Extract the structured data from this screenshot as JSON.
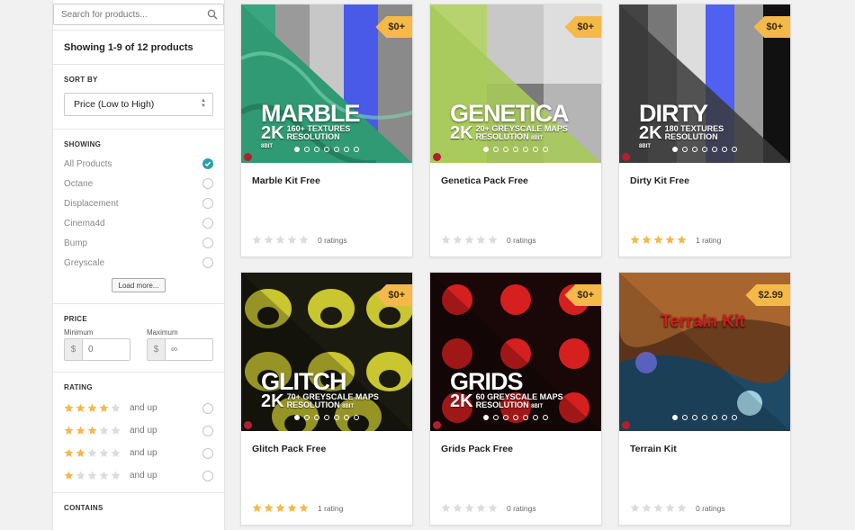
{
  "search": {
    "placeholder": "Search for products..."
  },
  "showing_count": "Showing 1-9 of 12 products",
  "sort": {
    "title": "SORT BY",
    "value": "Price (Low to High)"
  },
  "filter": {
    "title": "SHOWING",
    "options": [
      {
        "label": "All Products",
        "checked": true
      },
      {
        "label": "Octane",
        "checked": false
      },
      {
        "label": "Displacement",
        "checked": false
      },
      {
        "label": "Cinema4d",
        "checked": false
      },
      {
        "label": "Bump",
        "checked": false
      },
      {
        "label": "Greyscale",
        "checked": false
      }
    ],
    "load_more": "Load more..."
  },
  "price": {
    "title": "PRICE",
    "min_label": "Minimum",
    "max_label": "Maximum",
    "currency": "$",
    "min_placeholder": "0",
    "max_placeholder": "∞"
  },
  "rating": {
    "title": "RATING",
    "and_up": "and up",
    "levels": [
      4,
      3,
      2,
      1
    ]
  },
  "contains": {
    "title": "CONTAINS"
  },
  "colors": {
    "accent": "#2aa0a8",
    "star": "#f5b94a",
    "star_empty": "#dcdcdc",
    "tag": "#f5b94a"
  },
  "products": [
    {
      "name": "Marble Kit Free",
      "price": "$0+",
      "title": "MARBLE",
      "res": "2K",
      "line1": "160+ TEXTURES",
      "line2": "RESOLUTION",
      "line3": "8BIT",
      "rating": 0,
      "ratings_text": "0 ratings"
    },
    {
      "name": "Genetica Pack Free",
      "price": "$0+",
      "title": "GENETICA",
      "res": "2K",
      "line1": "20+ GREYSCALE MAPS",
      "line2": "RESOLUTION",
      "line3": "8BIT",
      "rating": 0,
      "ratings_text": "0 ratings"
    },
    {
      "name": "Dirty Kit Free",
      "price": "$0+",
      "title": "DIRTY",
      "res": "2K",
      "line1": "180 TEXTURES",
      "line2": "RESOLUTION",
      "line3": "8BIT",
      "rating": 5,
      "ratings_text": "1 rating"
    },
    {
      "name": "Glitch Pack Free",
      "price": "$0+",
      "title": "GLITCH",
      "res": "2K",
      "line1": "70+ GREYSCALE MAPS",
      "line2": "RESOLUTION",
      "line3": "8BIT",
      "rating": 5,
      "ratings_text": "1 rating"
    },
    {
      "name": "Grids Pack Free",
      "price": "$0+",
      "title": "GRIDS",
      "res": "2K",
      "line1": "60 GREYSCALE MAPS",
      "line2": "RESOLUTION",
      "line3": "8BIT",
      "rating": 0,
      "ratings_text": "0 ratings"
    },
    {
      "name": "Terrain Kit",
      "price": "$2.99",
      "title": "Terrain Kit",
      "res": "",
      "line1": "",
      "line2": "",
      "line3": "",
      "rating": 0,
      "ratings_text": "0 ratings"
    }
  ]
}
